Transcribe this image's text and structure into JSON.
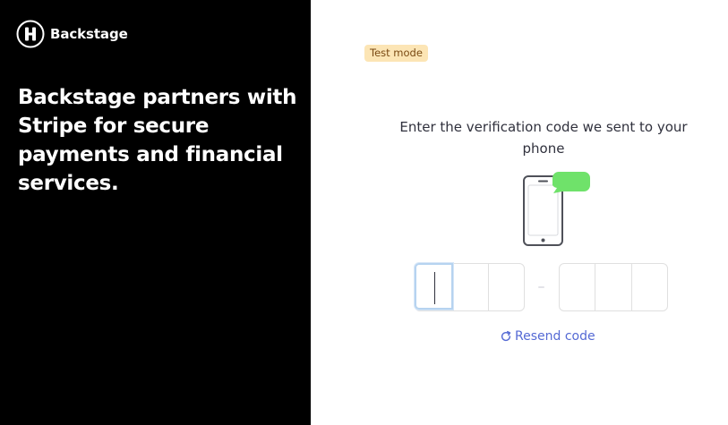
{
  "brand": {
    "name": "Backstage",
    "logo_icon": "backstage-logo-icon"
  },
  "headline": "Backstage partners with Stripe for secure payments and financial services.",
  "badge": {
    "label": "Test mode"
  },
  "verification": {
    "prompt": "Enter the verification code we sent to your phone",
    "illustration_icon": "phone-message-icon",
    "code": [
      "",
      "",
      "",
      "",
      "",
      ""
    ],
    "resend_label": "Resend code",
    "resend_icon": "refresh-icon"
  },
  "colors": {
    "left_panel_bg": "#000000",
    "badge_bg": "#fce5b5",
    "badge_text": "#7a4a13",
    "link": "#5469d4",
    "message_bubble": "#6fe26a",
    "focus_ring": "#b6d3f0"
  }
}
